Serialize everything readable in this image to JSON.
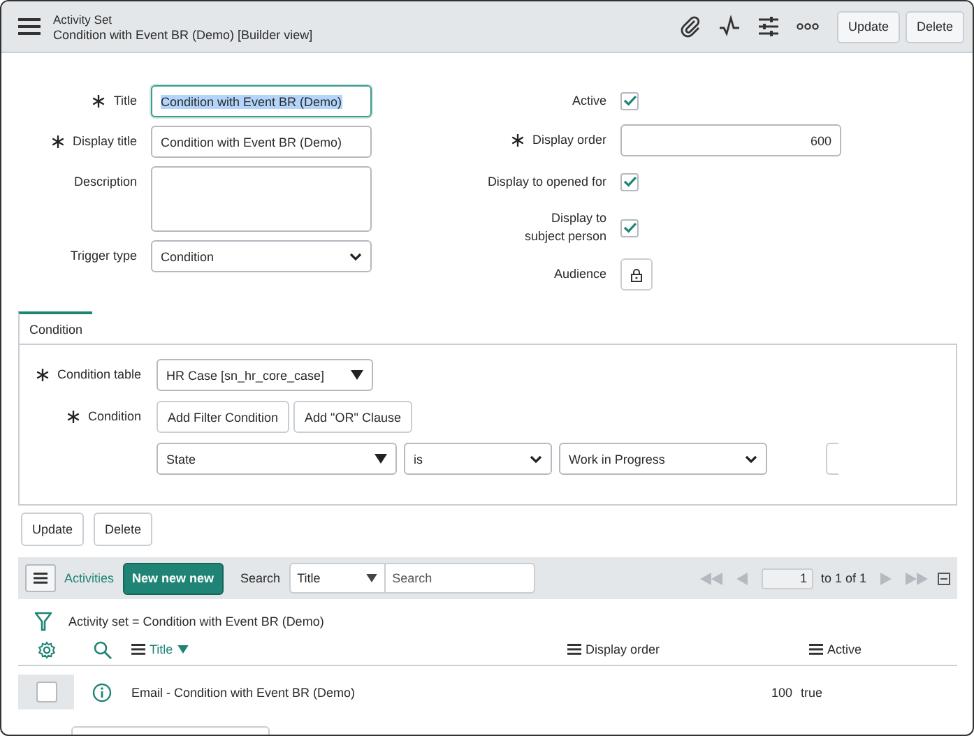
{
  "header": {
    "subtitle": "Activity Set",
    "title": "Condition with Event BR (Demo) [Builder view]",
    "buttons": [
      "Update",
      "Delete"
    ]
  },
  "form": {
    "left": [
      {
        "kind": "text",
        "label": "Title",
        "required": true,
        "value": "Condition with Event BR (Demo)",
        "focused": true
      },
      {
        "kind": "text",
        "label": "Display title",
        "required": true,
        "value": "Condition with Event BR (Demo)",
        "focused": false
      },
      {
        "kind": "textarea",
        "label": "Description",
        "required": false,
        "focused": false
      },
      {
        "kind": "select",
        "label": "Trigger type",
        "required": false,
        "value": "Condition",
        "focused": false
      }
    ],
    "right": [
      {
        "kind": "checkbox",
        "label": "Active",
        "required": false,
        "checked": true
      },
      {
        "kind": "number",
        "label": "Display order",
        "required": true,
        "value": "600"
      },
      {
        "kind": "checkbox",
        "label": "Display to opened for",
        "required": false,
        "checked": true
      },
      {
        "kind": "checkbox",
        "label": "Display to subject person",
        "required": false,
        "checked": true
      },
      {
        "kind": "lock",
        "label": "Audience",
        "required": false
      }
    ]
  },
  "section": {
    "tabs": [
      {
        "label": "Condition",
        "selected": true
      }
    ],
    "condition_table": {
      "label": "Condition table",
      "required": true,
      "value": "HR Case [sn_hr_core_case]"
    },
    "condition": {
      "label": "Condition",
      "required": true,
      "buttons": [
        "Add Filter Condition",
        "Add \"OR\" Clause"
      ]
    },
    "filter": {
      "field": "State",
      "operator": "is",
      "value": "Work in Progress"
    }
  },
  "form_buttons": [
    "Update",
    "Delete"
  ],
  "list": {
    "title": "Activities",
    "new_button": "New new new",
    "search_label": "Search",
    "search_field": "Title",
    "search_placeholder": "Search",
    "page": "1",
    "page_total": "to 1 of 1",
    "breadcrumb": "Activity set = Condition with Event BR (Demo)",
    "columns": [
      {
        "label": "Title",
        "sorted": true
      },
      {
        "label": "Display order",
        "sorted": false
      },
      {
        "label": "Active",
        "sorted": false
      }
    ],
    "rows": [
      {
        "title": "Email - Condition with Event BR (Demo)",
        "order": "100",
        "active": "true",
        "checked": false
      }
    ]
  }
}
